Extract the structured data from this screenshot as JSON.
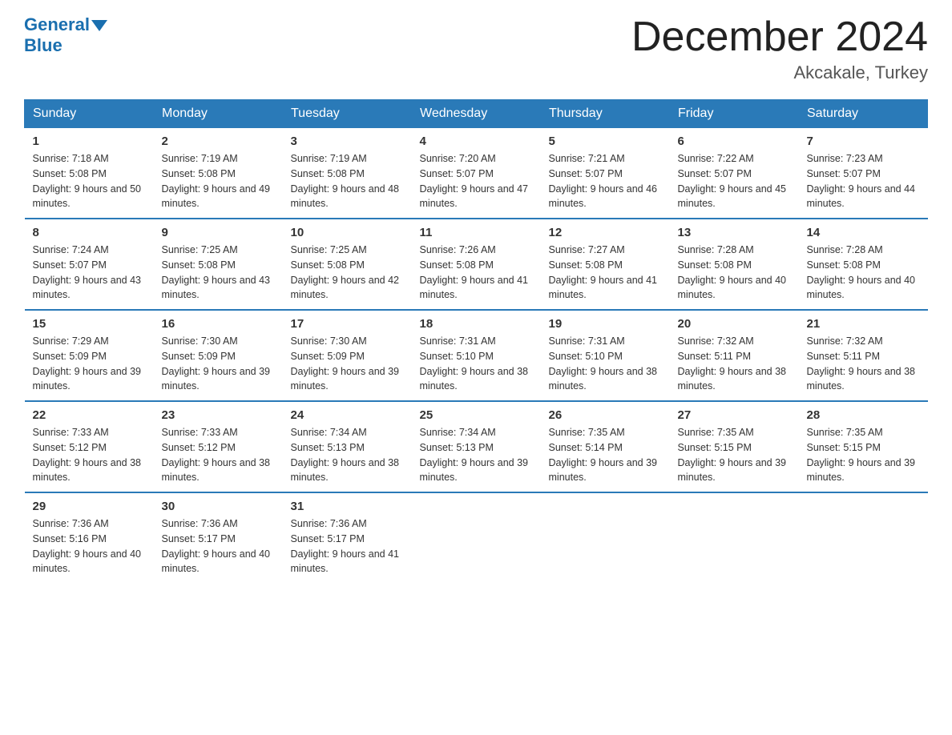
{
  "header": {
    "logo_general": "General",
    "logo_blue": "Blue",
    "month_title": "December 2024",
    "location": "Akcakale, Turkey"
  },
  "weekdays": [
    "Sunday",
    "Monday",
    "Tuesday",
    "Wednesday",
    "Thursday",
    "Friday",
    "Saturday"
  ],
  "weeks": [
    [
      {
        "day": "1",
        "sunrise": "7:18 AM",
        "sunset": "5:08 PM",
        "daylight": "9 hours and 50 minutes."
      },
      {
        "day": "2",
        "sunrise": "7:19 AM",
        "sunset": "5:08 PM",
        "daylight": "9 hours and 49 minutes."
      },
      {
        "day": "3",
        "sunrise": "7:19 AM",
        "sunset": "5:08 PM",
        "daylight": "9 hours and 48 minutes."
      },
      {
        "day": "4",
        "sunrise": "7:20 AM",
        "sunset": "5:07 PM",
        "daylight": "9 hours and 47 minutes."
      },
      {
        "day": "5",
        "sunrise": "7:21 AM",
        "sunset": "5:07 PM",
        "daylight": "9 hours and 46 minutes."
      },
      {
        "day": "6",
        "sunrise": "7:22 AM",
        "sunset": "5:07 PM",
        "daylight": "9 hours and 45 minutes."
      },
      {
        "day": "7",
        "sunrise": "7:23 AM",
        "sunset": "5:07 PM",
        "daylight": "9 hours and 44 minutes."
      }
    ],
    [
      {
        "day": "8",
        "sunrise": "7:24 AM",
        "sunset": "5:07 PM",
        "daylight": "9 hours and 43 minutes."
      },
      {
        "day": "9",
        "sunrise": "7:25 AM",
        "sunset": "5:08 PM",
        "daylight": "9 hours and 43 minutes."
      },
      {
        "day": "10",
        "sunrise": "7:25 AM",
        "sunset": "5:08 PM",
        "daylight": "9 hours and 42 minutes."
      },
      {
        "day": "11",
        "sunrise": "7:26 AM",
        "sunset": "5:08 PM",
        "daylight": "9 hours and 41 minutes."
      },
      {
        "day": "12",
        "sunrise": "7:27 AM",
        "sunset": "5:08 PM",
        "daylight": "9 hours and 41 minutes."
      },
      {
        "day": "13",
        "sunrise": "7:28 AM",
        "sunset": "5:08 PM",
        "daylight": "9 hours and 40 minutes."
      },
      {
        "day": "14",
        "sunrise": "7:28 AM",
        "sunset": "5:08 PM",
        "daylight": "9 hours and 40 minutes."
      }
    ],
    [
      {
        "day": "15",
        "sunrise": "7:29 AM",
        "sunset": "5:09 PM",
        "daylight": "9 hours and 39 minutes."
      },
      {
        "day": "16",
        "sunrise": "7:30 AM",
        "sunset": "5:09 PM",
        "daylight": "9 hours and 39 minutes."
      },
      {
        "day": "17",
        "sunrise": "7:30 AM",
        "sunset": "5:09 PM",
        "daylight": "9 hours and 39 minutes."
      },
      {
        "day": "18",
        "sunrise": "7:31 AM",
        "sunset": "5:10 PM",
        "daylight": "9 hours and 38 minutes."
      },
      {
        "day": "19",
        "sunrise": "7:31 AM",
        "sunset": "5:10 PM",
        "daylight": "9 hours and 38 minutes."
      },
      {
        "day": "20",
        "sunrise": "7:32 AM",
        "sunset": "5:11 PM",
        "daylight": "9 hours and 38 minutes."
      },
      {
        "day": "21",
        "sunrise": "7:32 AM",
        "sunset": "5:11 PM",
        "daylight": "9 hours and 38 minutes."
      }
    ],
    [
      {
        "day": "22",
        "sunrise": "7:33 AM",
        "sunset": "5:12 PM",
        "daylight": "9 hours and 38 minutes."
      },
      {
        "day": "23",
        "sunrise": "7:33 AM",
        "sunset": "5:12 PM",
        "daylight": "9 hours and 38 minutes."
      },
      {
        "day": "24",
        "sunrise": "7:34 AM",
        "sunset": "5:13 PM",
        "daylight": "9 hours and 38 minutes."
      },
      {
        "day": "25",
        "sunrise": "7:34 AM",
        "sunset": "5:13 PM",
        "daylight": "9 hours and 39 minutes."
      },
      {
        "day": "26",
        "sunrise": "7:35 AM",
        "sunset": "5:14 PM",
        "daylight": "9 hours and 39 minutes."
      },
      {
        "day": "27",
        "sunrise": "7:35 AM",
        "sunset": "5:15 PM",
        "daylight": "9 hours and 39 minutes."
      },
      {
        "day": "28",
        "sunrise": "7:35 AM",
        "sunset": "5:15 PM",
        "daylight": "9 hours and 39 minutes."
      }
    ],
    [
      {
        "day": "29",
        "sunrise": "7:36 AM",
        "sunset": "5:16 PM",
        "daylight": "9 hours and 40 minutes."
      },
      {
        "day": "30",
        "sunrise": "7:36 AM",
        "sunset": "5:17 PM",
        "daylight": "9 hours and 40 minutes."
      },
      {
        "day": "31",
        "sunrise": "7:36 AM",
        "sunset": "5:17 PM",
        "daylight": "9 hours and 41 minutes."
      },
      null,
      null,
      null,
      null
    ]
  ]
}
